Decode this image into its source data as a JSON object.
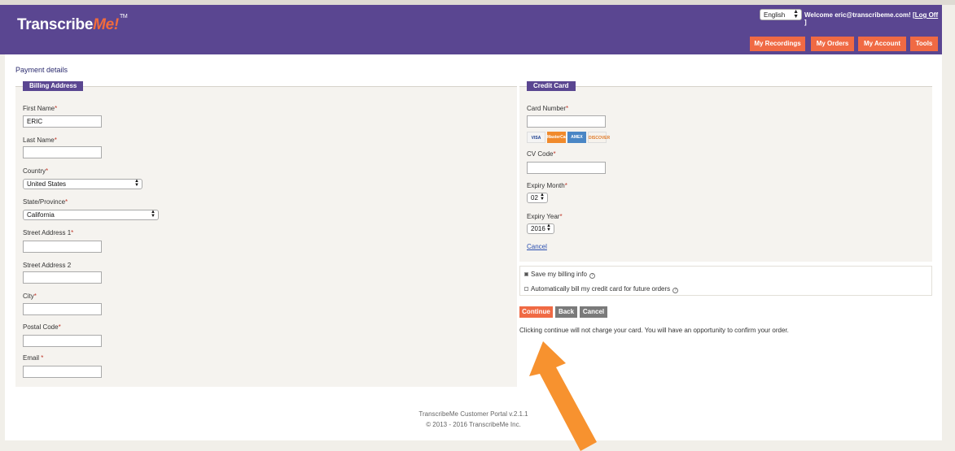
{
  "header": {
    "logo_main": "Transcribe",
    "logo_accent": "Me!",
    "logo_tm": "TM",
    "language": "English",
    "welcome_text": "Welcome eric@transcribeme.com! [",
    "logoff_label": "Log Off",
    "welcome_close": " ]",
    "nav": [
      "My Recordings",
      "My Orders",
      "My Account",
      "Tools"
    ]
  },
  "page_title": "Payment details",
  "billing": {
    "legend": "Billing Address",
    "first_name_label": "First Name",
    "first_name_value": "ERIC",
    "last_name_label": "Last Name",
    "last_name_value": "",
    "country_label": "Country",
    "country_value": "United States",
    "state_label": "State/Province",
    "state_value": "California",
    "street1_label": "Street Address 1",
    "street2_label": "Street Address 2",
    "city_label": "City",
    "postal_label": "Postal Code",
    "email_label": "Email",
    "required_mark": "*"
  },
  "credit_card": {
    "legend": "Credit Card",
    "card_number_label": "Card Number",
    "cards": [
      "VISA",
      "MasterCard",
      "AMEX",
      "DISCOVER"
    ],
    "cv_label": "CV Code",
    "expiry_month_label": "Expiry Month",
    "expiry_month_value": "02",
    "expiry_year_label": "Expiry Year",
    "expiry_year_value": "2016",
    "cancel_link": "Cancel"
  },
  "options": {
    "save_billing": "Save my billing info",
    "save_billing_checked": true,
    "auto_bill": "Automatically bill my credit card for future orders",
    "auto_bill_checked": false
  },
  "actions": {
    "continue": "Continue",
    "back": "Back",
    "cancel": "Cancel",
    "note": "Clicking continue will not charge your card. You will have an opportunity to confirm your order."
  },
  "footer": {
    "line1": "TranscribeMe Customer Portal v.2.1.1",
    "line2": "© 2013 - 2016 TranscribeMe Inc."
  },
  "colors": {
    "header_purple": "#5a4691",
    "accent_orange": "#f06a44",
    "button_gray": "#7a7a7a",
    "annotation_arrow": "#f7922f"
  }
}
